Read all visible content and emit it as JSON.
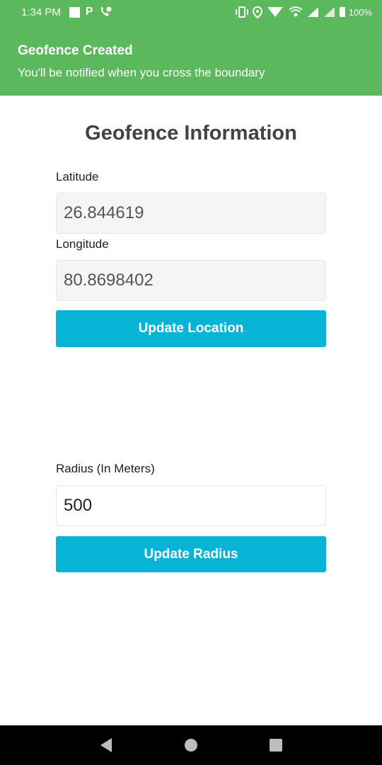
{
  "status_bar": {
    "time": "1:34 PM",
    "battery": "100%",
    "icons": [
      "square-notification-icon",
      "parking-icon",
      "phone-icon",
      "vibrate-icon",
      "location-icon",
      "wifi-icon",
      "data-arrows-icon",
      "signal-icon",
      "signal2-icon",
      "battery-icon"
    ]
  },
  "notification": {
    "title": "Geofence Created",
    "subtitle": "You'll be notified when you cross the boundary",
    "color": "#5cb85c"
  },
  "main": {
    "title": "Geofence Information",
    "latitude": {
      "label": "Latitude",
      "value": "26.844619"
    },
    "longitude": {
      "label": "Longitude",
      "value": "80.8698402"
    },
    "update_location_label": "Update Location",
    "radius": {
      "label": "Radius (In Meters)",
      "value": "500"
    },
    "update_radius_label": "Update Radius",
    "accent_color": "#07b4d6"
  },
  "nav_bar": {
    "icons": [
      "back-icon",
      "home-icon",
      "recents-icon"
    ]
  }
}
